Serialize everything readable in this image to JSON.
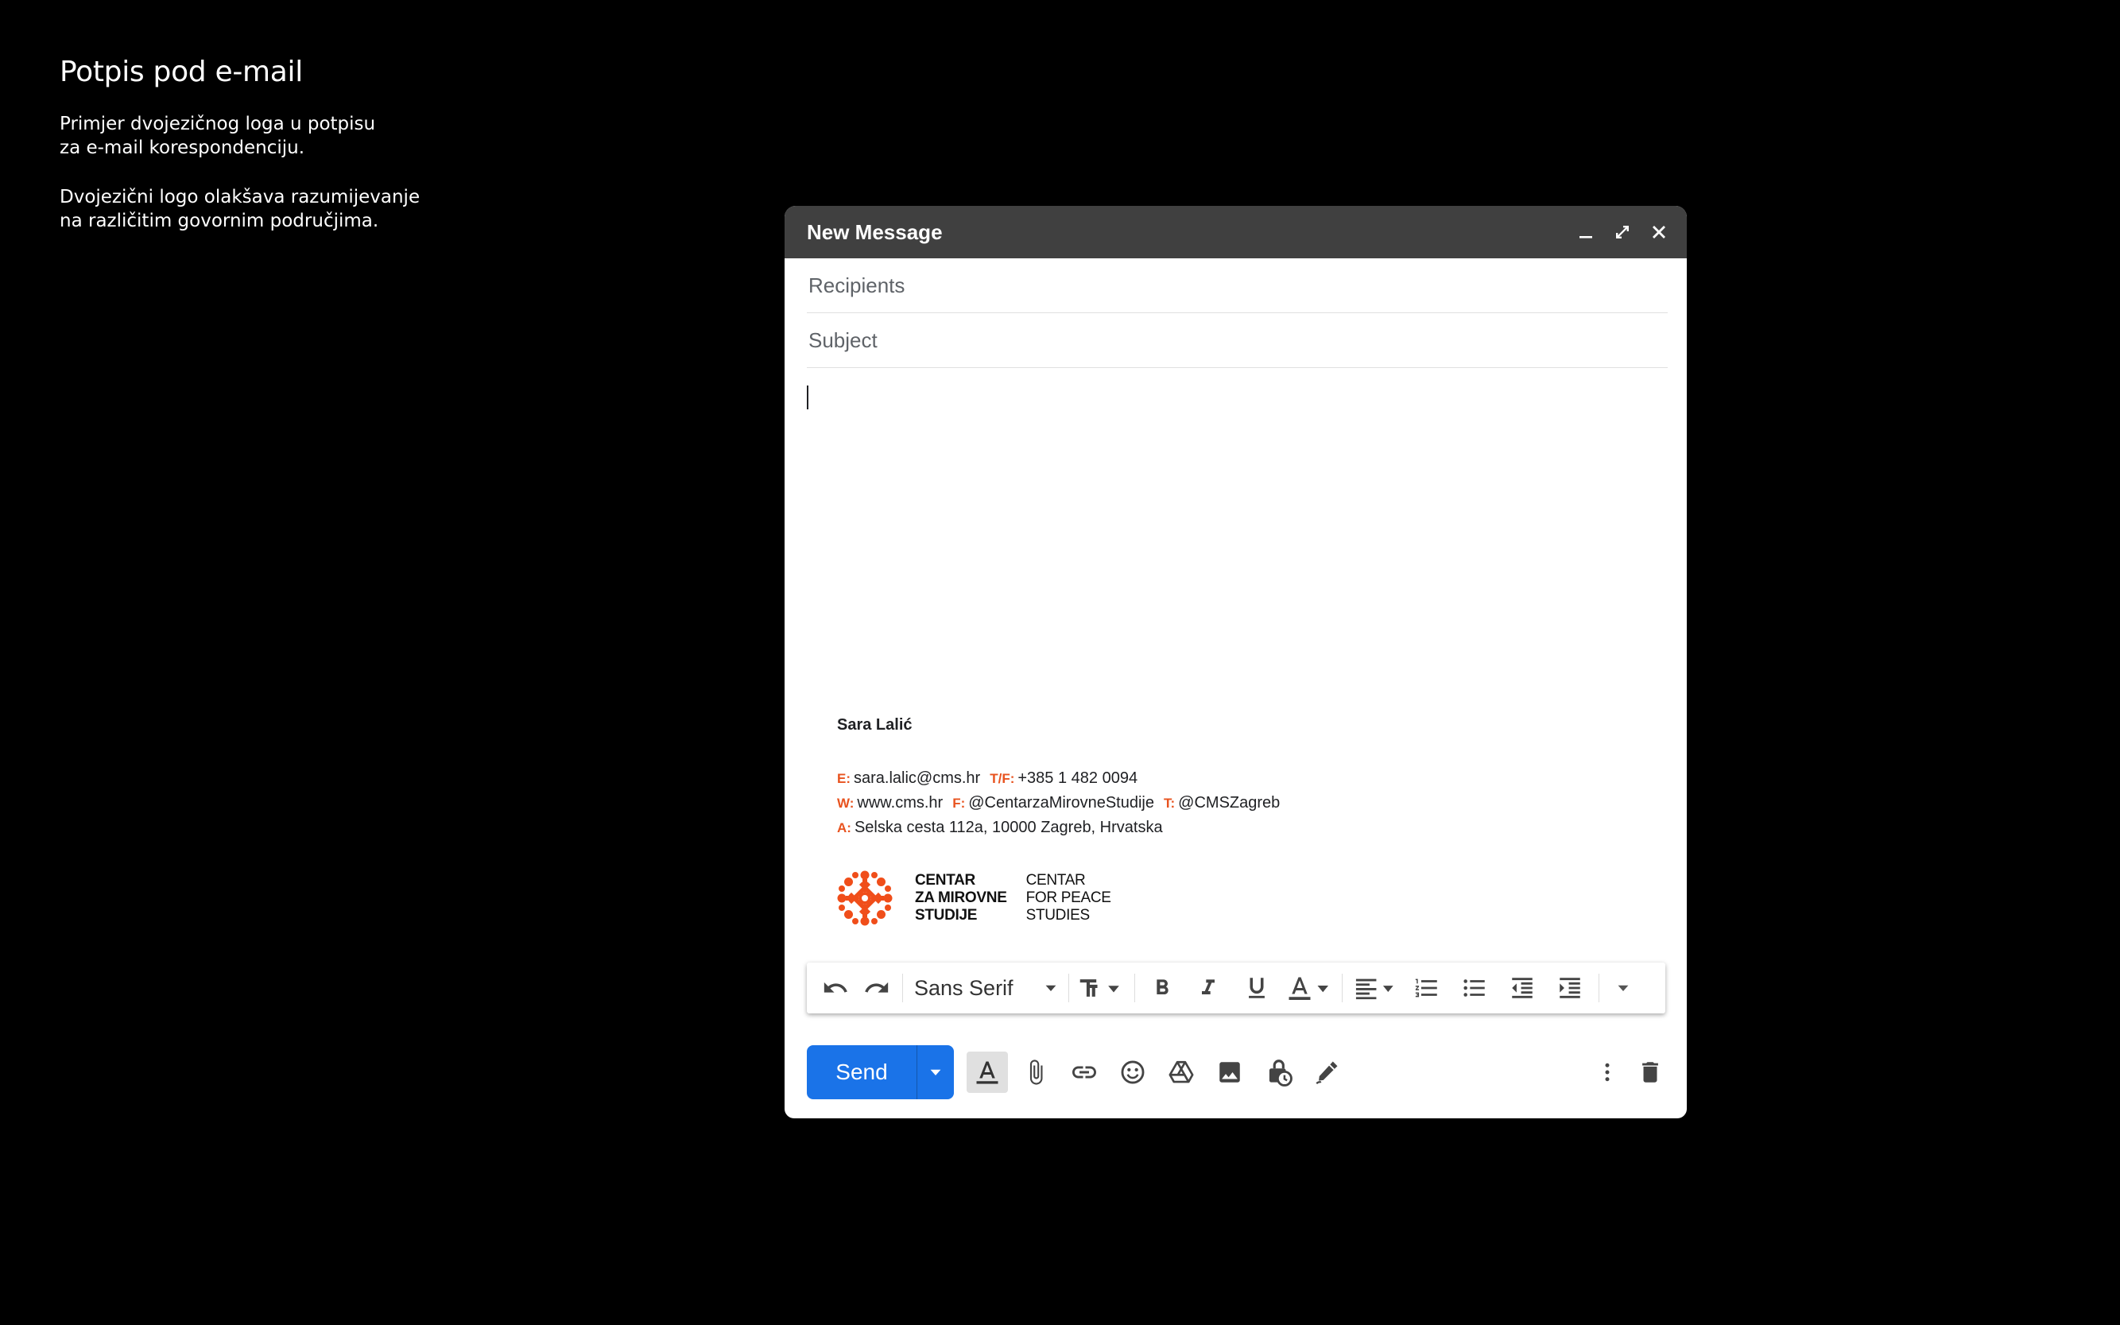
{
  "intro": {
    "title": "Potpis pod e-mail",
    "paragraph1": "Primjer dvojezičnog loga u potpisu\nza e-mail korespondenciju.",
    "paragraph2": "Dvojezični logo olakšava razumijevanje\nna različitim govornim područjima."
  },
  "compose": {
    "title": "New Message",
    "window_controls": [
      "minimize-icon",
      "expand-icon",
      "close-icon"
    ],
    "recipients_placeholder": "Recipients",
    "subject_placeholder": "Subject"
  },
  "signature": {
    "name": "Sara Lalić",
    "email_label": "E:",
    "email": "sara.lalic@cms.hr",
    "phone_label": "T/F:",
    "phone": "+385 1 482 0094",
    "web_label": "W:",
    "web": "www.cms.hr",
    "facebook_label": "F:",
    "facebook": "@CentarzaMirovneStudije",
    "twitter_label": "T:",
    "twitter": "@CMSZagreb",
    "address_label": "A:",
    "address": "Selska cesta 112a, 10000 Zagreb, Hrvatska",
    "label_color": "#e8531f",
    "logo": {
      "text_hr": "CENTAR\nZA MIROVNE\nSTUDIJE",
      "text_en": "CENTAR\nFOR PEACE\nSTUDIES",
      "color": "#f04e1a"
    }
  },
  "toolbar": {
    "font": "Sans Serif",
    "icons": [
      "undo-icon",
      "redo-icon",
      "font-size-icon",
      "bold-icon",
      "italic-icon",
      "underline-icon",
      "text-color-icon",
      "align-icon",
      "numbered-list-icon",
      "bulleted-list-icon",
      "indent-less-icon",
      "indent-more-icon",
      "more-formatting-icon"
    ]
  },
  "bottom": {
    "send_label": "Send",
    "icons": [
      "formatting-options-icon",
      "attach-icon",
      "link-icon",
      "emoji-icon",
      "drive-icon",
      "photo-icon",
      "confidential-icon",
      "signature-icon",
      "more-options-icon",
      "discard-icon"
    ],
    "accent": "#1a73e8"
  }
}
